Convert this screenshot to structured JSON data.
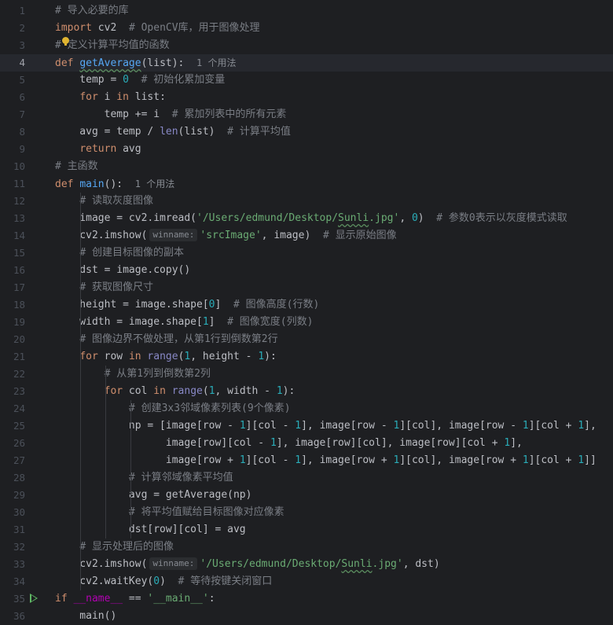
{
  "editor": {
    "lines": [
      {
        "n": "1",
        "parts": [
          {
            "t": "# 导入必要的库",
            "c": "cm"
          }
        ]
      },
      {
        "n": "2",
        "parts": [
          {
            "t": "import",
            "c": "kw"
          },
          {
            "t": " cv2  "
          },
          {
            "t": "# OpenCV库，用于图像处理",
            "c": "cm"
          }
        ]
      },
      {
        "n": "3",
        "parts": [
          {
            "t": "# 定义计算平均值的函数",
            "c": "cm"
          }
        ]
      },
      {
        "n": "4",
        "parts": [
          {
            "t": "def",
            "c": "kw"
          },
          {
            "t": " "
          },
          {
            "t": "getAverage",
            "c": "fn wavy"
          },
          {
            "t": "(list):  "
          },
          {
            "t": "1 个用法",
            "c": "hint"
          }
        ]
      },
      {
        "n": "5",
        "parts": [
          {
            "t": "    temp = "
          },
          {
            "t": "0",
            "c": "num"
          },
          {
            "t": "  "
          },
          {
            "t": "# 初始化累加变量",
            "c": "cm"
          }
        ]
      },
      {
        "n": "6",
        "parts": [
          {
            "t": "    "
          },
          {
            "t": "for",
            "c": "kw"
          },
          {
            "t": " i "
          },
          {
            "t": "in",
            "c": "kw"
          },
          {
            "t": " list:"
          }
        ]
      },
      {
        "n": "7",
        "parts": [
          {
            "t": "        temp += i  "
          },
          {
            "t": "# 累加列表中的所有元素",
            "c": "cm"
          }
        ]
      },
      {
        "n": "8",
        "parts": [
          {
            "t": "    avg = temp / "
          },
          {
            "t": "len",
            "c": "bi"
          },
          {
            "t": "(list)  "
          },
          {
            "t": "# 计算平均值",
            "c": "cm"
          }
        ]
      },
      {
        "n": "9",
        "parts": [
          {
            "t": "    "
          },
          {
            "t": "return",
            "c": "kw"
          },
          {
            "t": " avg"
          }
        ]
      },
      {
        "n": "10",
        "parts": [
          {
            "t": "# 主函数",
            "c": "cm"
          }
        ]
      },
      {
        "n": "11",
        "parts": [
          {
            "t": "def",
            "c": "kw"
          },
          {
            "t": " "
          },
          {
            "t": "main",
            "c": "fn"
          },
          {
            "t": "():  "
          },
          {
            "t": "1 个用法",
            "c": "hint"
          }
        ]
      },
      {
        "n": "12",
        "parts": [
          {
            "t": "    "
          },
          {
            "t": "# 读取灰度图像",
            "c": "cm"
          }
        ]
      },
      {
        "n": "13",
        "parts": [
          {
            "t": "    image = cv2.imread("
          },
          {
            "t": "'/Users/edmund/Desktop/",
            "c": "str"
          },
          {
            "t": "Sunli",
            "c": "str wavy"
          },
          {
            "t": ".jpg'",
            "c": "str"
          },
          {
            "t": ", "
          },
          {
            "t": "0",
            "c": "num"
          },
          {
            "t": ")  "
          },
          {
            "t": "# 参数0表示以灰度模式读取",
            "c": "cm"
          }
        ]
      },
      {
        "n": "14",
        "parts": [
          {
            "t": "    cv2.imshow("
          },
          {
            "t": "winname:",
            "c": "pill"
          },
          {
            "t": "'srcImage'",
            "c": "str"
          },
          {
            "t": ", image)  "
          },
          {
            "t": "# 显示原始图像",
            "c": "cm"
          }
        ]
      },
      {
        "n": "15",
        "parts": [
          {
            "t": "    "
          },
          {
            "t": "# 创建目标图像的副本",
            "c": "cm"
          }
        ]
      },
      {
        "n": "16",
        "parts": [
          {
            "t": "    dst = image.copy()"
          }
        ]
      },
      {
        "n": "17",
        "parts": [
          {
            "t": "    "
          },
          {
            "t": "# 获取图像尺寸",
            "c": "cm"
          }
        ]
      },
      {
        "n": "18",
        "parts": [
          {
            "t": "    height = image.shape["
          },
          {
            "t": "0",
            "c": "num"
          },
          {
            "t": "]  "
          },
          {
            "t": "# 图像高度(行数)",
            "c": "cm"
          }
        ]
      },
      {
        "n": "19",
        "parts": [
          {
            "t": "    width = image.shape["
          },
          {
            "t": "1",
            "c": "num"
          },
          {
            "t": "]  "
          },
          {
            "t": "# 图像宽度(列数)",
            "c": "cm"
          }
        ]
      },
      {
        "n": "20",
        "parts": [
          {
            "t": "    "
          },
          {
            "t": "# 图像边界不做处理，从第1行到倒数第2行",
            "c": "cm"
          }
        ]
      },
      {
        "n": "21",
        "parts": [
          {
            "t": "    "
          },
          {
            "t": "for",
            "c": "kw"
          },
          {
            "t": " row "
          },
          {
            "t": "in",
            "c": "kw"
          },
          {
            "t": " "
          },
          {
            "t": "range",
            "c": "bi"
          },
          {
            "t": "("
          },
          {
            "t": "1",
            "c": "num"
          },
          {
            "t": ", height - "
          },
          {
            "t": "1",
            "c": "num"
          },
          {
            "t": "):"
          }
        ]
      },
      {
        "n": "22",
        "parts": [
          {
            "t": "        "
          },
          {
            "t": "# 从第1列到倒数第2列",
            "c": "cm"
          }
        ]
      },
      {
        "n": "23",
        "parts": [
          {
            "t": "        "
          },
          {
            "t": "for",
            "c": "kw"
          },
          {
            "t": " col "
          },
          {
            "t": "in",
            "c": "kw"
          },
          {
            "t": " "
          },
          {
            "t": "range",
            "c": "bi"
          },
          {
            "t": "("
          },
          {
            "t": "1",
            "c": "num"
          },
          {
            "t": ", width - "
          },
          {
            "t": "1",
            "c": "num"
          },
          {
            "t": "):"
          }
        ]
      },
      {
        "n": "24",
        "parts": [
          {
            "t": "            "
          },
          {
            "t": "# 创建3x3邻域像素列表(9个像素)",
            "c": "cm"
          }
        ]
      },
      {
        "n": "25",
        "parts": [
          {
            "t": "            np = [image[row - "
          },
          {
            "t": "1",
            "c": "num"
          },
          {
            "t": "][col - "
          },
          {
            "t": "1",
            "c": "num"
          },
          {
            "t": "], image[row - "
          },
          {
            "t": "1",
            "c": "num"
          },
          {
            "t": "][col], image[row - "
          },
          {
            "t": "1",
            "c": "num"
          },
          {
            "t": "][col + "
          },
          {
            "t": "1",
            "c": "num"
          },
          {
            "t": "],"
          }
        ]
      },
      {
        "n": "26",
        "parts": [
          {
            "t": "                  image[row][col - "
          },
          {
            "t": "1",
            "c": "num"
          },
          {
            "t": "], image[row][col], image[row][col + "
          },
          {
            "t": "1",
            "c": "num"
          },
          {
            "t": "],"
          }
        ]
      },
      {
        "n": "27",
        "parts": [
          {
            "t": "                  image[row + "
          },
          {
            "t": "1",
            "c": "num"
          },
          {
            "t": "][col - "
          },
          {
            "t": "1",
            "c": "num"
          },
          {
            "t": "], image[row + "
          },
          {
            "t": "1",
            "c": "num"
          },
          {
            "t": "][col], image[row + "
          },
          {
            "t": "1",
            "c": "num"
          },
          {
            "t": "][col + "
          },
          {
            "t": "1",
            "c": "num"
          },
          {
            "t": "]]"
          }
        ]
      },
      {
        "n": "28",
        "parts": [
          {
            "t": "            "
          },
          {
            "t": "# 计算邻域像素平均值",
            "c": "cm"
          }
        ]
      },
      {
        "n": "29",
        "parts": [
          {
            "t": "            avg = getAverage(np)"
          }
        ]
      },
      {
        "n": "30",
        "parts": [
          {
            "t": "            "
          },
          {
            "t": "# 将平均值赋给目标图像对应像素",
            "c": "cm"
          }
        ]
      },
      {
        "n": "31",
        "parts": [
          {
            "t": "            dst[row][col] = avg"
          }
        ]
      },
      {
        "n": "32",
        "parts": [
          {
            "t": "    "
          },
          {
            "t": "# 显示处理后的图像",
            "c": "cm"
          }
        ]
      },
      {
        "n": "33",
        "parts": [
          {
            "t": "    cv2.imshow("
          },
          {
            "t": "winname:",
            "c": "pill"
          },
          {
            "t": "'/Users/edmund/Desktop/",
            "c": "str"
          },
          {
            "t": "Sunli",
            "c": "str wavy"
          },
          {
            "t": ".jpg'",
            "c": "str"
          },
          {
            "t": ", dst)"
          }
        ]
      },
      {
        "n": "34",
        "parts": [
          {
            "t": "    cv2.waitKey("
          },
          {
            "t": "0",
            "c": "num"
          },
          {
            "t": ")  "
          },
          {
            "t": "# 等待按键关闭窗口",
            "c": "cm"
          }
        ]
      },
      {
        "n": "35",
        "parts": [
          {
            "t": "if",
            "c": "kw"
          },
          {
            "t": " "
          },
          {
            "t": "__name__",
            "c": "dunder"
          },
          {
            "t": " == "
          },
          {
            "t": "'__main__'",
            "c": "str"
          },
          {
            "t": ":"
          }
        ]
      },
      {
        "n": "36",
        "parts": [
          {
            "t": "    main()"
          }
        ]
      }
    ],
    "current_line": "4",
    "run_icon": "run-triangle-icon",
    "intention_icon": "lightbulb-icon",
    "colors": {
      "background": "#1e1f22",
      "keyword": "#cf8e6d",
      "function": "#56a8f5",
      "number": "#2aacb8",
      "string": "#6aab73",
      "comment": "#7a7e85",
      "builtin": "#8888c6"
    }
  }
}
